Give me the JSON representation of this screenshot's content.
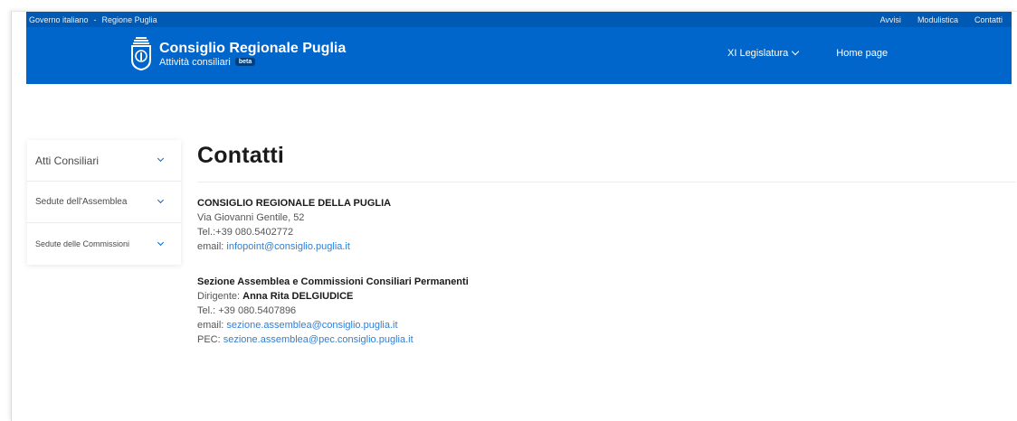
{
  "slim_header": {
    "left_links": [
      "Governo italiano",
      "Regione Puglia"
    ],
    "separator": "-",
    "right_links": [
      "Avvisi",
      "Modulistica",
      "Contatti"
    ]
  },
  "header": {
    "title": "Consiglio Regionale Puglia",
    "subtitle": "Attività consiliari",
    "badge": "beta",
    "nav": {
      "legislature": "XI Legislatura",
      "home": "Home page"
    }
  },
  "sidebar": {
    "items": [
      {
        "label": "Atti Consiliari"
      },
      {
        "label": "Sedute dell'Assemblea"
      },
      {
        "label": "Sedute delle Commissioni"
      }
    ]
  },
  "main": {
    "title": "Contatti",
    "block1": {
      "heading": "CONSIGLIO REGIONALE DELLA PUGLIA",
      "address": "Via Giovanni Gentile, 52",
      "tel": "Tel.:+39 080.5402772",
      "email_label": "email:",
      "email": "infopoint@consiglio.puglia.it"
    },
    "block2": {
      "heading": "Sezione Assemblea e Commissioni Consiliari Permanenti",
      "dirigente_label": "Dirigente:",
      "dirigente_name": "Anna Rita DELGIUDICE",
      "tel": "Tel.: +39 080.5407896",
      "email_label": "email:",
      "email": "sezione.assemblea@consiglio.puglia.it",
      "pec_label": "PEC:",
      "pec": "sezione.assemblea@pec.consiglio.puglia.it"
    }
  },
  "colors": {
    "header_blue": "#0066cc",
    "slim_blue": "#0059b3",
    "link": "#2f7fd6"
  }
}
